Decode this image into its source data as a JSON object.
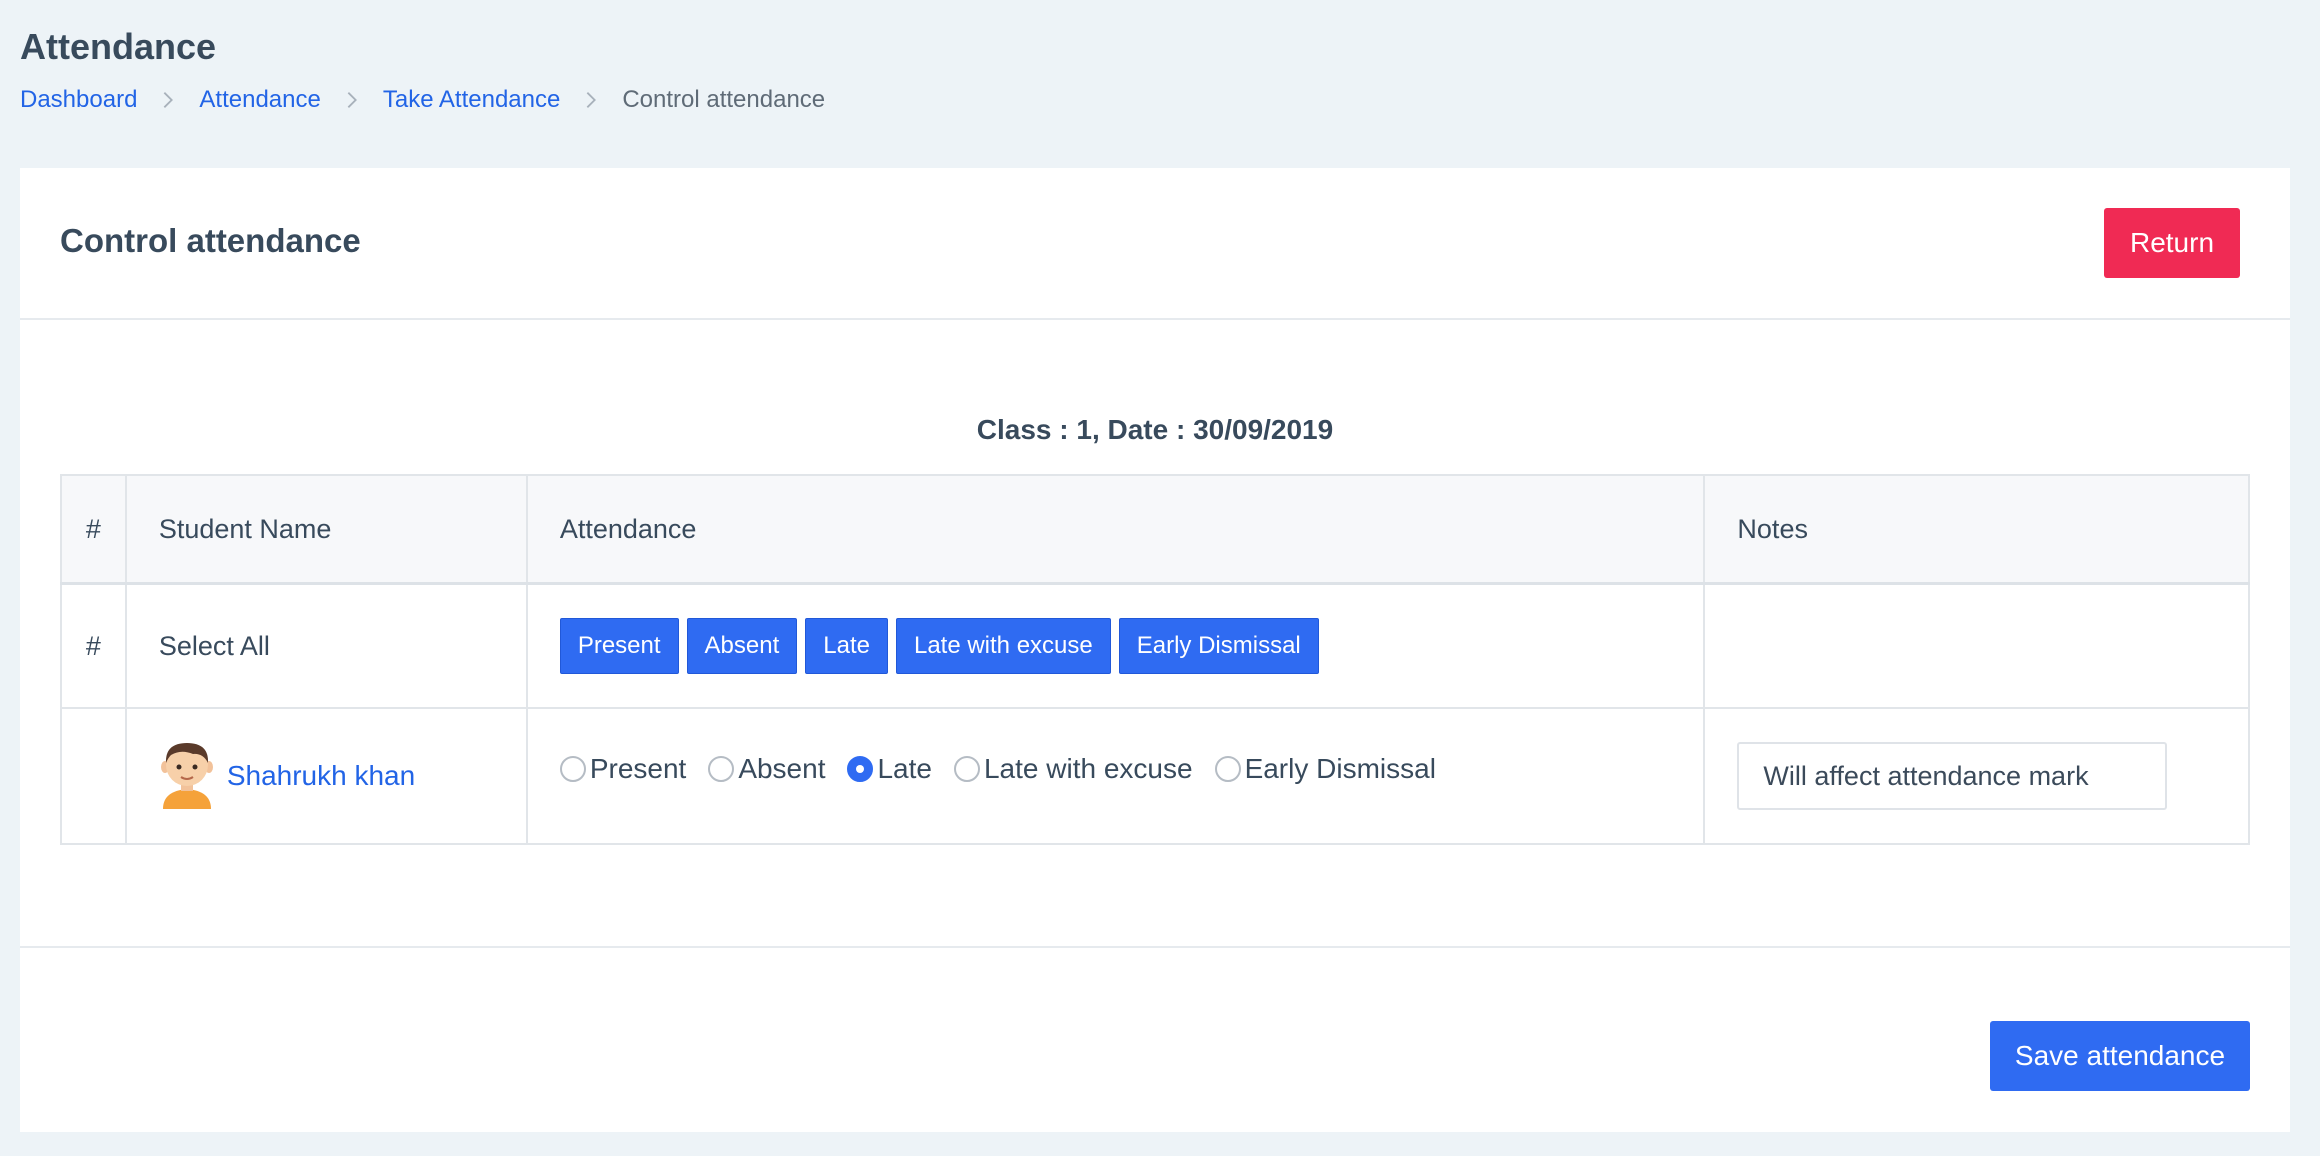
{
  "page": {
    "title": "Attendance"
  },
  "breadcrumb": {
    "items": [
      "Dashboard",
      "Attendance",
      "Take Attendance"
    ],
    "current": "Control attendance"
  },
  "card": {
    "title": "Control attendance",
    "return_label": "Return",
    "class_date": "Class : 1, Date : 30/09/2019",
    "save_label": "Save attendance"
  },
  "table": {
    "headers": [
      "#",
      "Student Name",
      "Attendance",
      "Notes"
    ],
    "select_all": {
      "num": "#",
      "label": "Select All",
      "buttons": [
        "Present",
        "Absent",
        "Late",
        "Late with excuse",
        "Early Dismissal"
      ]
    },
    "student": {
      "name": "Shahrukh khan",
      "options": [
        "Present",
        "Absent",
        "Late",
        "Late with excuse",
        "Early Dismissal"
      ],
      "selected": "Late",
      "notes_value": "Will affect attendance mark"
    }
  },
  "colors": {
    "primary": "#2f6bf2",
    "danger": "#f02a54",
    "background": "#edf3f7",
    "link": "#2264e6"
  },
  "icons": {
    "breadcrumb_separator": "chevron-right-icon",
    "student_avatar": "boy-avatar-icon"
  }
}
